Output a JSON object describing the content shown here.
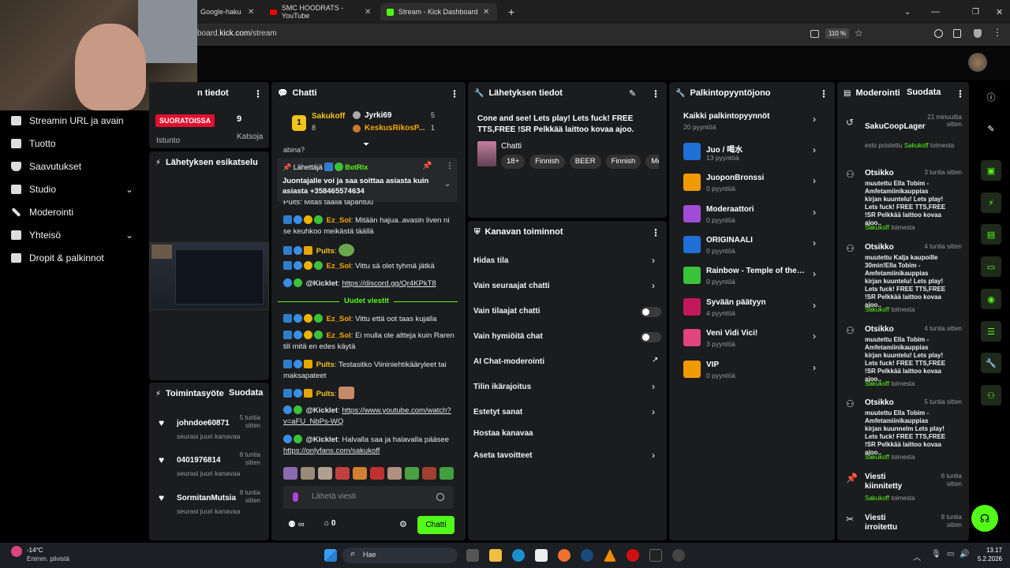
{
  "browser": {
    "tabs": [
      {
        "label": "Google-haku",
        "active": false
      },
      {
        "label": "SMC HOODRATS - YouTube",
        "active": false
      },
      {
        "label": "Stream - Kick Dashboard",
        "active": true
      }
    ],
    "url_prefix": "board.",
    "url_domain": "kick.com",
    "url_path": "/stream",
    "zoom": "110 %"
  },
  "sidebar": {
    "items": [
      {
        "label": "Streamin URL ja avain",
        "icon": "link-icon"
      },
      {
        "label": "Tuotto",
        "icon": "wallet-icon"
      },
      {
        "label": "Saavutukset",
        "icon": "trophy-icon"
      },
      {
        "label": "Studio",
        "icon": "studio-icon",
        "chevron": true
      },
      {
        "label": "Moderointi",
        "icon": "wrench-icon"
      },
      {
        "label": "Yhteisö",
        "icon": "community-icon",
        "chevron": true
      },
      {
        "label": "Dropit & palkinnot",
        "icon": "gift-icon"
      }
    ]
  },
  "stream_info": {
    "title": "n tiedot",
    "live_badge": "SUORATOISSA",
    "viewers": "9",
    "watching_label": "Istunto",
    "watch_label": "Katsoja",
    "preview_title": "Lähetyksen esikatselu"
  },
  "activity": {
    "title": "Toimintasyöte",
    "filter": "Suodata",
    "events": [
      {
        "name": "johndoe60871",
        "time": "5 tuntia sitten",
        "desc": "seurasi juuri kanavaa"
      },
      {
        "name": "0401976814",
        "time": "8 tuntia sitten",
        "desc": "seurasi juuri kanavaa"
      },
      {
        "name": "SormitanMutsia",
        "time": "8 tuntia sitten",
        "desc": "seurasi juuri kanavaa"
      }
    ]
  },
  "chat": {
    "title": "Chatti",
    "leaderboard": {
      "first": "Sakukoff",
      "first_score": "8",
      "second": "Jyrki69",
      "second_score": "5",
      "third": "KeskusRikosP...",
      "third_score": "1"
    },
    "truncated_top": "abina?",
    "pinned_label": "Lähettäjä",
    "pinned_user": "BotRix",
    "pinned_text": "Juontajalle voi ja saa soittaa asiasta kuin asiasta +358465574634",
    "partial_msg": "Pults: Mitäs täällä tapahtuu",
    "messages": [
      {
        "user": "Ez_Sol",
        "text": "Mitään hajua..avasin liven ni se keuhkoo meikästä täällä",
        "color": "#f4a700"
      },
      {
        "user": "Pults",
        "text": "",
        "color": "#f0c419",
        "emote": true
      },
      {
        "user": "Ez_Sol",
        "text": "Vittu sä olet tyhmä jätkä",
        "color": "#f4a700"
      },
      {
        "user": "@Kicklet",
        "text": "",
        "link": "https://discord.gg/Qr4KPkT8",
        "color": "#e6e6e6"
      }
    ],
    "new_messages_divider": "Uudet viestit",
    "messages_after": [
      {
        "user": "Ez_Sol",
        "text": "Vittu että oot taas kujalla",
        "color": "#f4a700"
      },
      {
        "user": "Ez_Sol",
        "text": "Ei mulla ole altteja kuin Raren till mitä en edes käytä",
        "color": "#f4a700"
      },
      {
        "user": "Pults",
        "text": "Testasitko Viininiehtikääryleet tai maksapateet",
        "color": "#f0c419"
      },
      {
        "user": "Pults",
        "text": "",
        "color": "#f0c419",
        "emote": true
      },
      {
        "user": "@Kicklet",
        "text": "",
        "link": "https://www.youtube.com/watch?v=aFU_NbPs-WQ",
        "color": "#e6e6e6"
      },
      {
        "user": "@Kicklet",
        "text": "Halvalla saa ja halavalla pääsee ",
        "link": "https://onlyfans.com/sakukoff",
        "color": "#e6e6e6"
      }
    ],
    "input_placeholder": "Lähetä viesti",
    "points": "0",
    "send_label": "Chatti"
  },
  "broadcast": {
    "title": "Lähetyksen tiedot",
    "stream_title": "Cone and see! Lets play! Lets fuck! FREE TTS,FREE !SR Pelkkää laittoo kovaa ajoo.",
    "category": "Chatti",
    "tags": [
      "18+",
      "Finnish",
      "BEER",
      "Finnish",
      "Me"
    ]
  },
  "channel_actions": {
    "title": "Kanavan toiminnot",
    "items": [
      {
        "label": "Hidas tila",
        "control": "arrow"
      },
      {
        "label": "Vain seuraajat chatti",
        "control": "arrow"
      },
      {
        "label": "Vain tilaajat chatti",
        "control": "toggle"
      },
      {
        "label": "Vain hymiöitä chat",
        "control": "toggle"
      },
      {
        "label": "AI Chat-moderointi",
        "control": "external"
      },
      {
        "label": "Tilin ikärajoitus",
        "control": "arrow"
      },
      {
        "label": "Estetyt sanat",
        "control": "arrow"
      },
      {
        "label": "Hostaa kanavaa",
        "control": "none"
      },
      {
        "label": "Aseta tavoitteet",
        "control": "arrow"
      }
    ]
  },
  "rewards": {
    "title": "Palkintopyyntöjono",
    "all_label": "Kaikki palkintopyynnöt",
    "all_count": "20 pyyntöä",
    "items": [
      {
        "name": "Juo / 喝水",
        "count": "13 pyyntöä",
        "color": "#1f6fd6"
      },
      {
        "name": "JuoponBronssi",
        "count": "0 pyyntöä",
        "color": "#f09a00"
      },
      {
        "name": "Moderaattori",
        "count": "0 pyyntöä",
        "color": "#a24bd9"
      },
      {
        "name": "ORIGINAALI",
        "count": "0 pyyntöä",
        "color": "#1f6fd6"
      },
      {
        "name": "Rainbow - Temple of the King",
        "count": "0 pyyntöä",
        "color": "#3ac23a"
      },
      {
        "name": "Syvään päätyyn",
        "count": "4 pyyntöä",
        "color": "#c2185b"
      },
      {
        "name": "Veni Vidi Vici!",
        "count": "3 pyyntöä",
        "color": "#e0457b"
      },
      {
        "name": "VIP",
        "count": "0 pyyntöä",
        "color": "#f09a00"
      }
    ]
  },
  "moderation": {
    "title": "Moderointi",
    "filter": "Suodata",
    "entries": [
      {
        "icon": "undo-icon",
        "title": "SakuCoopLager",
        "time": "21 minuuttia sitten",
        "body": "",
        "foot_prefix": "esto poistettu ",
        "foot_user": "Sakukoff",
        "foot_suffix": " toimesta"
      },
      {
        "icon": "user-edit-icon",
        "title": "Otsikko",
        "time": "3 tuntia sitten",
        "body": "muutettu Ella Tobim - Amfetamiinikauppias kirjan kuuntelu! Lets play! Lets fuck! FREE TTS,FREE !SR Pelkkää laittoo kovaa ajoo..",
        "foot_prefix": "",
        "foot_user": "Sakukoff",
        "foot_suffix": " toimesta"
      },
      {
        "icon": "user-edit-icon",
        "title": "Otsikko",
        "time": "4 tuntia sitten",
        "body": "muutettu Kalja kaupoille 30min!Ella Tobim - Amfetamiinikauppias kirjan kuuntelu! Lets play! Lets fuck! FREE TTS,FREE !SR Pelkkää laittoo kovaa ajoo..",
        "foot_prefix": "",
        "foot_user": "Sakukoff",
        "foot_suffix": " toimesta"
      },
      {
        "icon": "user-edit-icon",
        "title": "Otsikko",
        "time": "4 tuntia sitten",
        "body": "muutettu Ella Tobim - Amfetamiinikauppias kirjan kuuntelu! Lets play! Lets fuck! FREE TTS,FREE !SR Pelkkää laittoo kovaa ajoo..",
        "foot_prefix": "",
        "foot_user": "Sakukoff",
        "foot_suffix": " toimesta"
      },
      {
        "icon": "user-edit-icon",
        "title": "Otsikko",
        "time": "5 tuntia sitten",
        "body": "muutettu Ella Tobim - Amfetamiinikauppias kirjan kuunnelm Lets play! Lets fuck! FREE TTS,FREE !SR Pelkkää laittoo kovaa ajoo..",
        "foot_prefix": "",
        "foot_user": "Sakukoff",
        "foot_suffix": " toimesta"
      },
      {
        "icon": "pin-icon",
        "title": "Viesti kiinnitetty",
        "time": "6 tuntia sitten",
        "body": "",
        "foot_prefix": "",
        "foot_user": "Sakukoff",
        "foot_suffix": " toimesta"
      },
      {
        "icon": "unpin-icon",
        "title": "Viesti irroitettu",
        "time": "8 tuntia sitten",
        "body": "",
        "foot_prefix": "",
        "foot_user": "",
        "foot_suffix": ""
      }
    ]
  },
  "taskbar": {
    "weather_temp": "-14°C",
    "weather_desc": "Enimm. pilvistä",
    "search_label": "Hae",
    "time": "13.17",
    "date": "5.2.2026"
  }
}
